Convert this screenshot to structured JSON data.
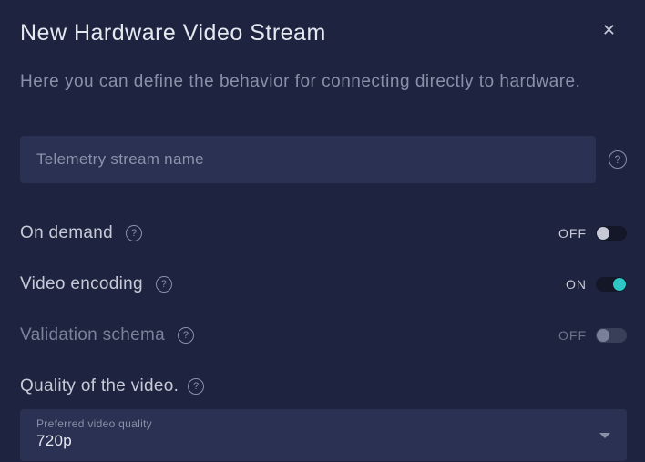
{
  "header": {
    "title": "New Hardware Video Stream",
    "subtitle": "Here you can define the behavior for connecting directly to hardware."
  },
  "nameField": {
    "placeholder": "Telemetry stream name",
    "value": ""
  },
  "settings": {
    "onDemand": {
      "label": "On demand",
      "state": "OFF"
    },
    "encoding": {
      "label": "Video encoding",
      "state": "ON"
    },
    "validation": {
      "label": "Validation schema",
      "state": "OFF"
    }
  },
  "quality": {
    "sectionLabel": "Quality of the video.",
    "floatingLabel": "Preferred video quality",
    "value": "720p"
  }
}
